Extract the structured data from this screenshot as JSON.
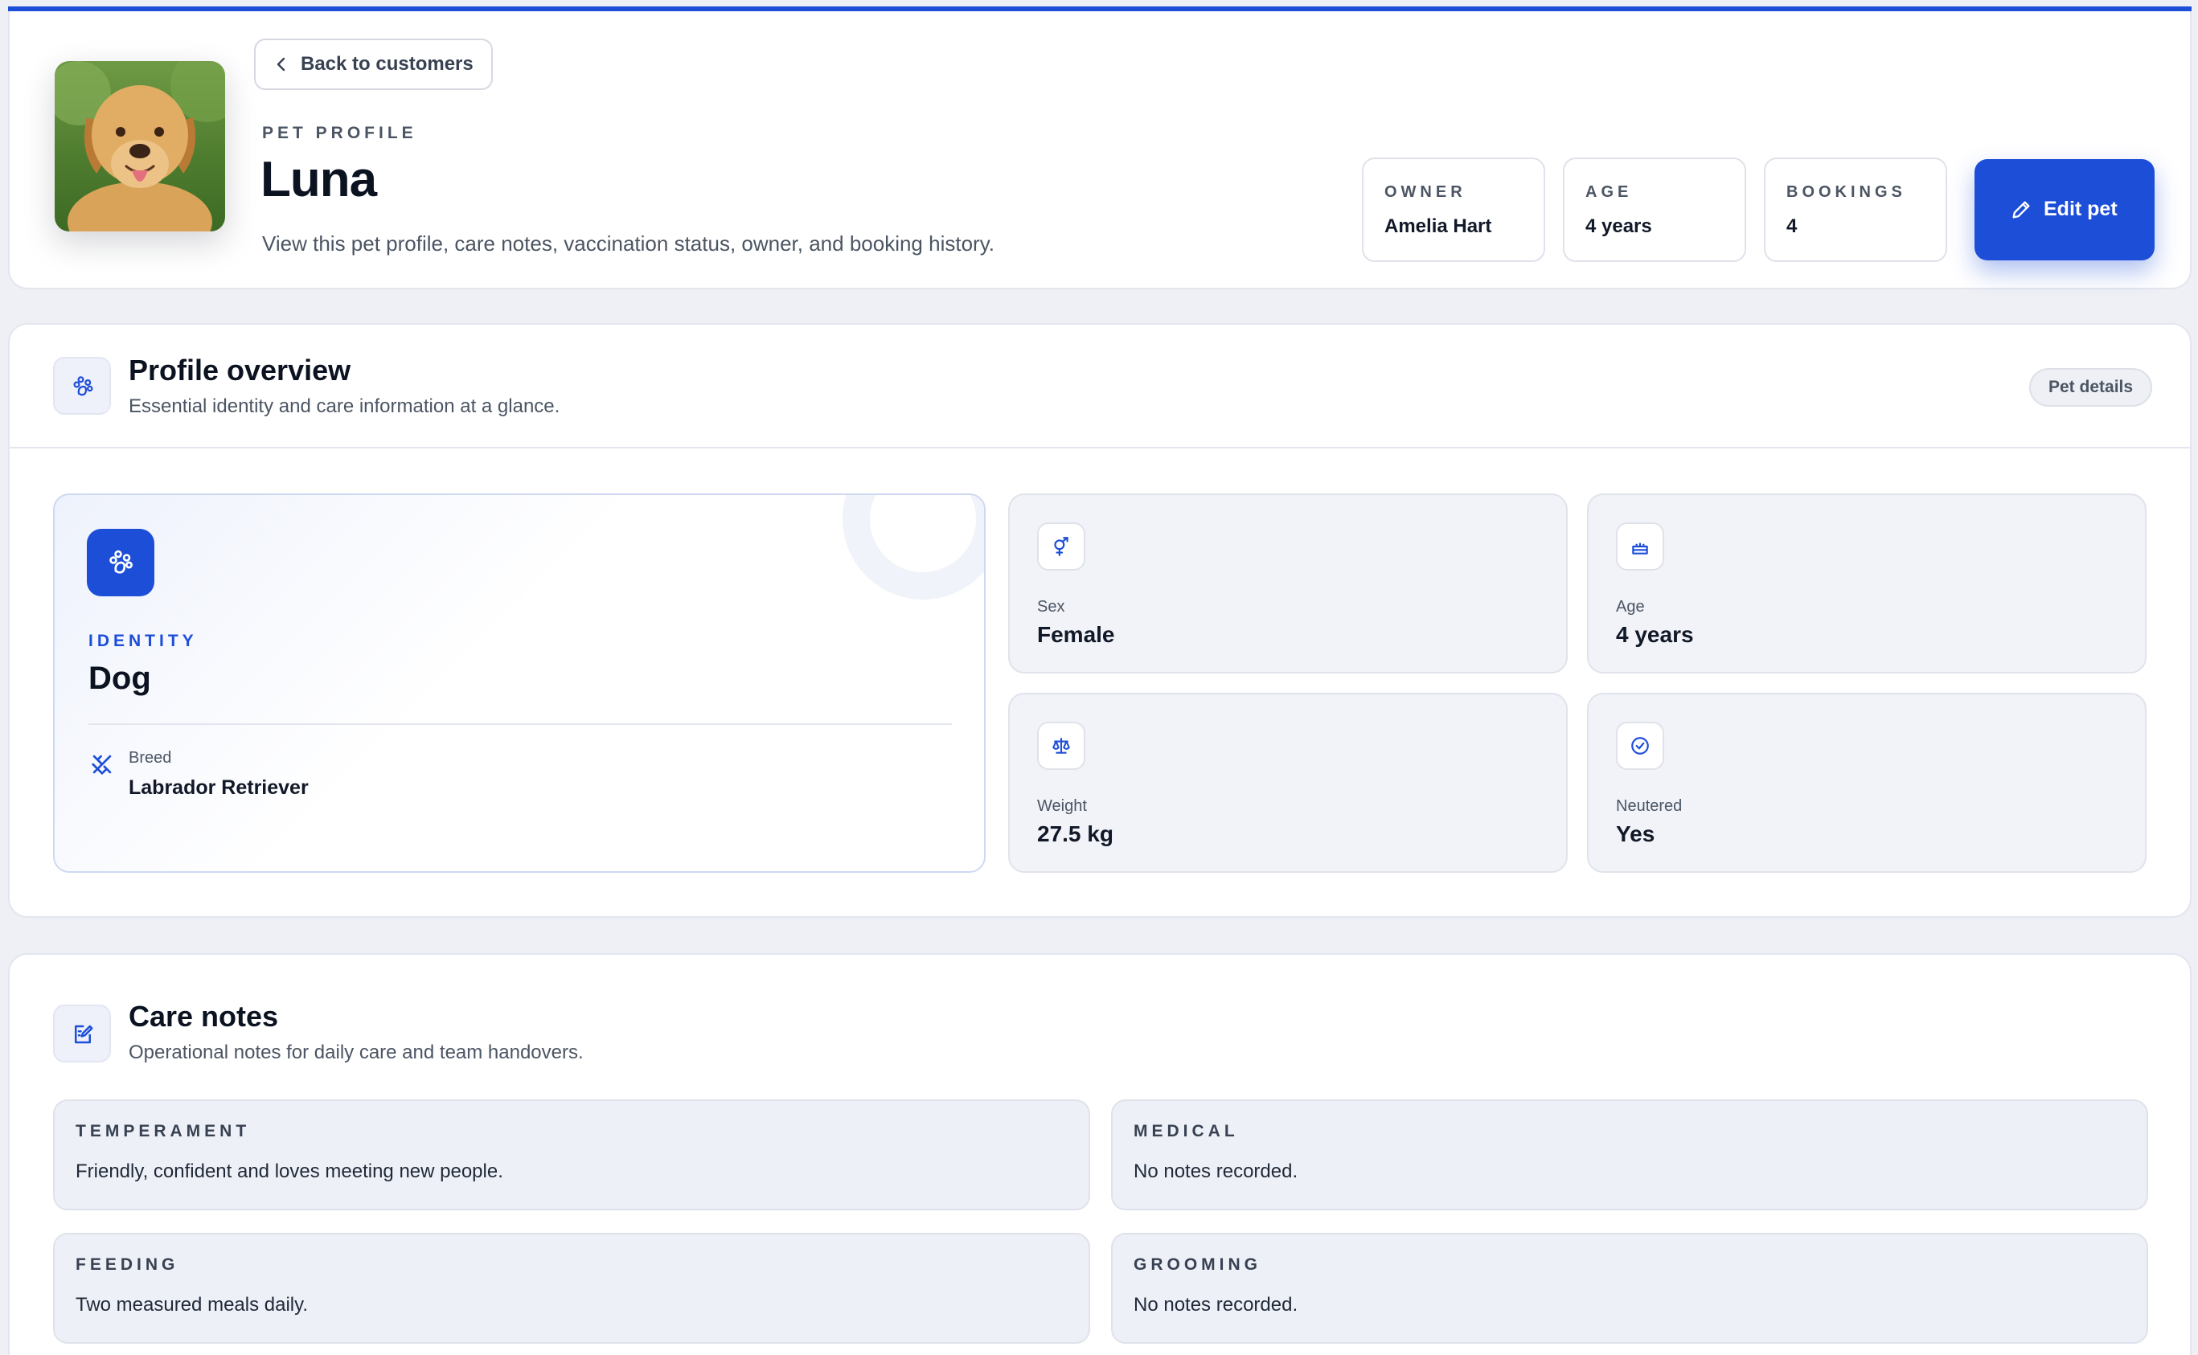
{
  "header": {
    "back_label": "Back to customers",
    "eyebrow": "PET PROFILE",
    "pet_name": "Luna",
    "description": "View this pet profile, care notes, vaccination status, owner, and booking history.",
    "stats": [
      {
        "label": "OWNER",
        "value": "Amelia Hart"
      },
      {
        "label": "AGE",
        "value": "4 years"
      },
      {
        "label": "BOOKINGS",
        "value": "4"
      }
    ],
    "edit_label": "Edit pet"
  },
  "overview": {
    "title": "Profile overview",
    "subtitle": "Essential identity and care information at a glance.",
    "badge": "Pet details",
    "identity": {
      "tag": "IDENTITY",
      "kind": "Dog",
      "breed_label": "Breed",
      "breed_value": "Labrador Retriever"
    },
    "attributes": [
      {
        "label": "Sex",
        "value": "Female",
        "icon": "gender-icon"
      },
      {
        "label": "Age",
        "value": "4 years",
        "icon": "cake-icon"
      },
      {
        "label": "Weight",
        "value": "27.5 kg",
        "icon": "scale-icon"
      },
      {
        "label": "Neutered",
        "value": "Yes",
        "icon": "check-circle-icon"
      }
    ]
  },
  "care_notes": {
    "title": "Care notes",
    "subtitle": "Operational notes for daily care and team handovers.",
    "notes": [
      {
        "label": "TEMPERAMENT",
        "value": "Friendly, confident and loves meeting new people."
      },
      {
        "label": "MEDICAL",
        "value": "No notes recorded."
      },
      {
        "label": "FEEDING",
        "value": "Two measured meals daily."
      },
      {
        "label": "GROOMING",
        "value": "No notes recorded."
      }
    ]
  },
  "colors": {
    "accent": "#1d4ed8",
    "page_bg": "#eef0f5",
    "card_bg": "#ffffff"
  }
}
